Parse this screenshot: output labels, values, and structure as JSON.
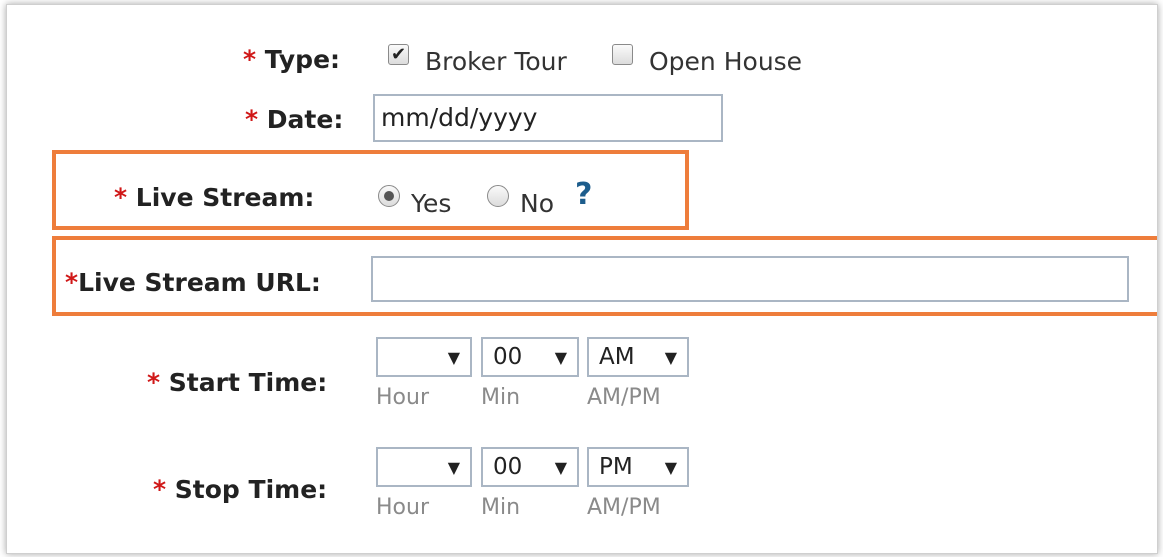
{
  "form": {
    "type": {
      "required_mark": "*",
      "label": "Type:",
      "options": [
        {
          "label": "Broker Tour",
          "checked": true
        },
        {
          "label": "Open House",
          "checked": false
        }
      ]
    },
    "date": {
      "required_mark": "*",
      "label": "Date:",
      "value": "mm/dd/yyyy"
    },
    "live_stream": {
      "required_mark": "*",
      "label": "Live Stream:",
      "options": [
        {
          "label": "Yes",
          "selected": true
        },
        {
          "label": "No",
          "selected": false
        }
      ],
      "help": "?"
    },
    "live_stream_url": {
      "required_mark": "*",
      "label": "Live Stream URL:",
      "value": ""
    },
    "start_time": {
      "required_mark": "*",
      "label": "Start Time:",
      "hour": "",
      "min": "00",
      "ampm": "AM",
      "hour_caption": "Hour",
      "min_caption": "Min",
      "ampm_caption": "AM/PM"
    },
    "stop_time": {
      "required_mark": "*",
      "label": "Stop Time:",
      "hour": "",
      "min": "00",
      "ampm": "PM",
      "hour_caption": "Hour",
      "min_caption": "Min",
      "ampm_caption": "AM/PM"
    }
  },
  "highlight_color": "#ee7d3b",
  "required_color": "#d01818",
  "help_icon_color": "#1d5d8c",
  "icons": {
    "dropdown": "triangle-down",
    "help": "question-mark",
    "checkbox_check": "check-mark"
  }
}
